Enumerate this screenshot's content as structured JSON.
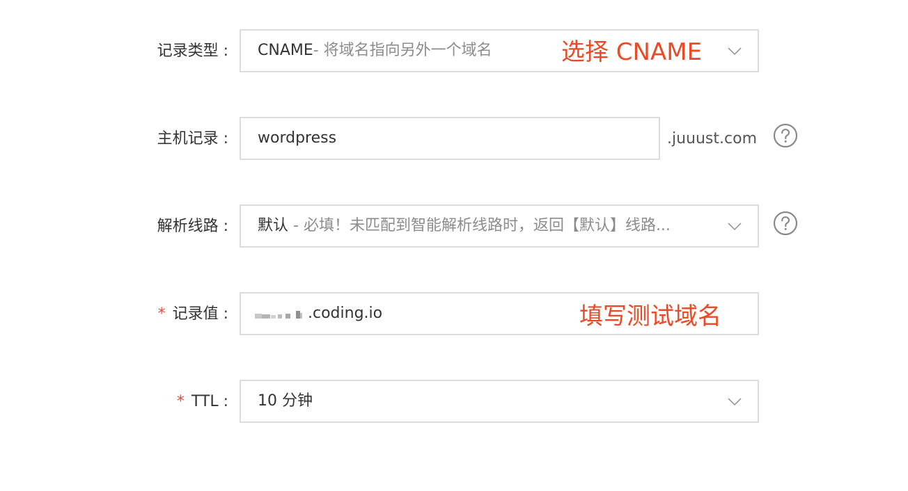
{
  "record_type": {
    "label": "记录类型 :",
    "value_main": "CNAME",
    "value_desc": "- 将域名指向另外一个域名",
    "annotation": "选择 CNAME"
  },
  "host_record": {
    "label": "主机记录 :",
    "value": "wordpress",
    "suffix": ".juuust.com"
  },
  "route": {
    "label": "解析线路 :",
    "value_main": "默认",
    "value_desc": " - 必填！未匹配到智能解析线路时，返回【默认】线路..."
  },
  "record_value": {
    "required_mark": "*",
    "label": "记录值 :",
    "value_visible": ".coding.io",
    "annotation": "填写测试域名"
  },
  "ttl": {
    "required_mark": "*",
    "label": "TTL :",
    "value": "10 分钟"
  },
  "icons": {
    "dropdown": "chevron-down-icon",
    "help": "question-circle-icon"
  },
  "colors": {
    "annotation": "#ea4a25",
    "required": "#e34d36",
    "border": "#dcdcdc"
  }
}
